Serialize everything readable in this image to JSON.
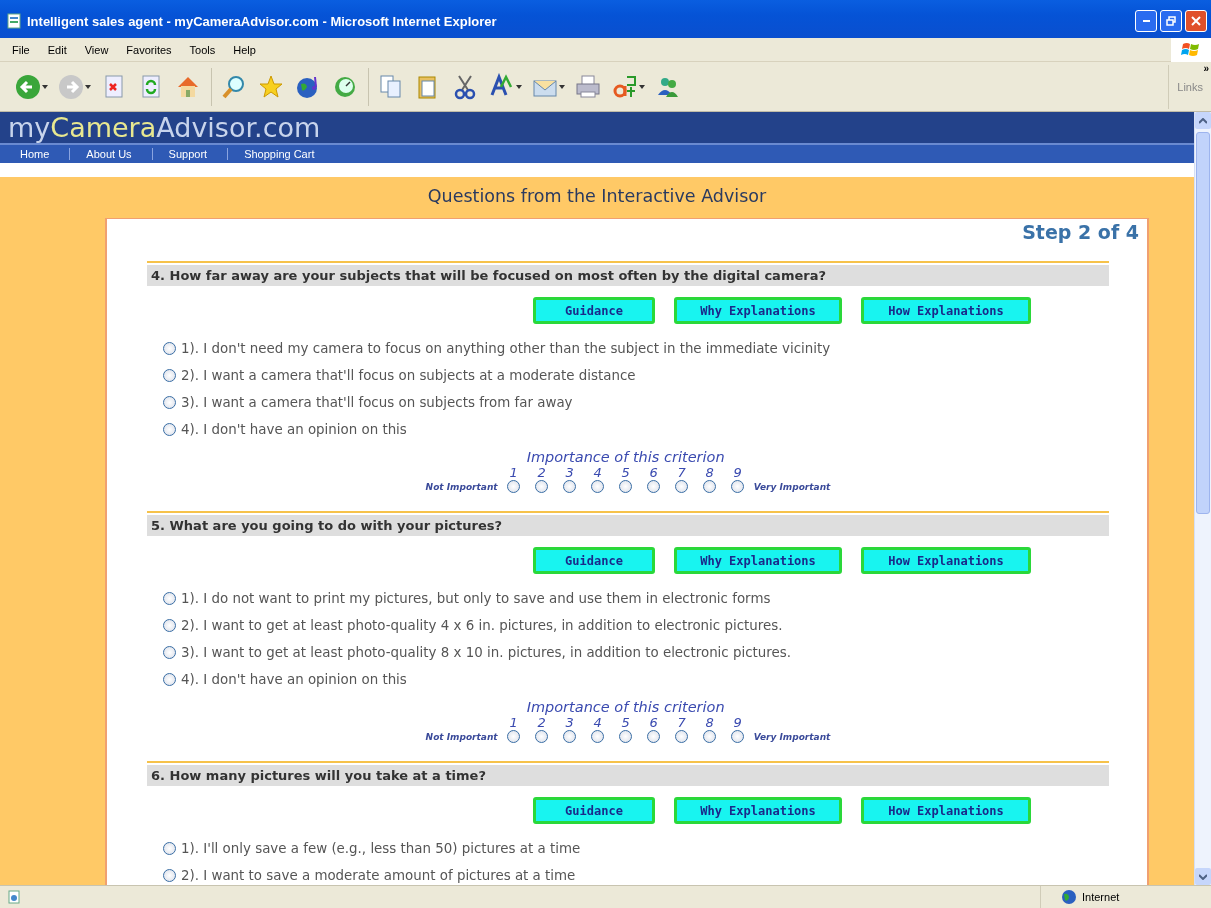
{
  "window": {
    "title": "Intelligent sales agent - myCameraAdvisor.com - Microsoft Internet Explorer"
  },
  "menu": [
    "File",
    "Edit",
    "View",
    "Favorites",
    "Tools",
    "Help"
  ],
  "toolbar": {
    "links_label": "Links",
    "overflow": "»"
  },
  "site": {
    "logo": [
      {
        "text": "my",
        "highlight": false
      },
      {
        "text": "Camera",
        "highlight": true
      },
      {
        "text": "Advisor.com",
        "highlight": false
      }
    ],
    "nav": [
      "Home",
      "About Us",
      "Support",
      "Shopping Cart"
    ]
  },
  "heading": "Questions from the Interactive Advisor",
  "step": "Step 2 of 4",
  "questions": [
    {
      "title": "4. How far away are your subjects that will be focused on most often by the digital camera?",
      "buttons": [
        "Guidance",
        "Why Explanations",
        "How Explanations"
      ],
      "options": [
        {
          "label": "1). I don't need my camera to focus on anything other than the subject in the immediate vicinity",
          "selected": false
        },
        {
          "label": "2). I want a camera that'll focus on subjects at a moderate distance",
          "selected": false
        },
        {
          "label": "3). I want a camera that'll focus on subjects from far away",
          "selected": false
        },
        {
          "label": "4). I don't have an opinion on this",
          "selected": false
        }
      ],
      "importance": {
        "title": "Importance of this criterion",
        "low": "Not Important",
        "high": "Very Important",
        "scale": [
          {
            "label": "1",
            "selected": false
          },
          {
            "label": "2",
            "selected": false
          },
          {
            "label": "3",
            "selected": false
          },
          {
            "label": "4",
            "selected": false
          },
          {
            "label": "5",
            "selected": false
          },
          {
            "label": "6",
            "selected": false
          },
          {
            "label": "7",
            "selected": false
          },
          {
            "label": "8",
            "selected": false
          },
          {
            "label": "9",
            "selected": false
          }
        ]
      }
    },
    {
      "title": "5. What are you going to do with your pictures?",
      "buttons": [
        "Guidance",
        "Why Explanations",
        "How Explanations"
      ],
      "options": [
        {
          "label": "1). I do not want to print my pictures, but only to save and use them in electronic forms",
          "selected": false
        },
        {
          "label": "2). I want to get at least photo-quality 4 x 6 in. pictures, in addition to electronic pictures.",
          "selected": false
        },
        {
          "label": "3). I want to get at least photo-quality 8 x 10 in. pictures, in addition to electronic pictures.",
          "selected": false
        },
        {
          "label": "4). I don't have an opinion on this",
          "selected": false
        }
      ],
      "importance": {
        "title": "Importance of this criterion",
        "low": "Not Important",
        "high": "Very Important",
        "scale": [
          {
            "label": "1",
            "selected": false
          },
          {
            "label": "2",
            "selected": false
          },
          {
            "label": "3",
            "selected": false
          },
          {
            "label": "4",
            "selected": false
          },
          {
            "label": "5",
            "selected": false
          },
          {
            "label": "6",
            "selected": false
          },
          {
            "label": "7",
            "selected": false
          },
          {
            "label": "8",
            "selected": false
          },
          {
            "label": "9",
            "selected": false
          }
        ]
      }
    },
    {
      "title": "6. How many pictures will you take at a time?",
      "buttons": [
        "Guidance",
        "Why Explanations",
        "How Explanations"
      ],
      "options": [
        {
          "label": "1). I'll only save a few (e.g., less than 50) pictures at a time",
          "selected": false
        },
        {
          "label": "2). I want to save a moderate amount of pictures at a time",
          "selected": false
        }
      ]
    }
  ],
  "status_bar": {
    "zone": "Internet"
  }
}
